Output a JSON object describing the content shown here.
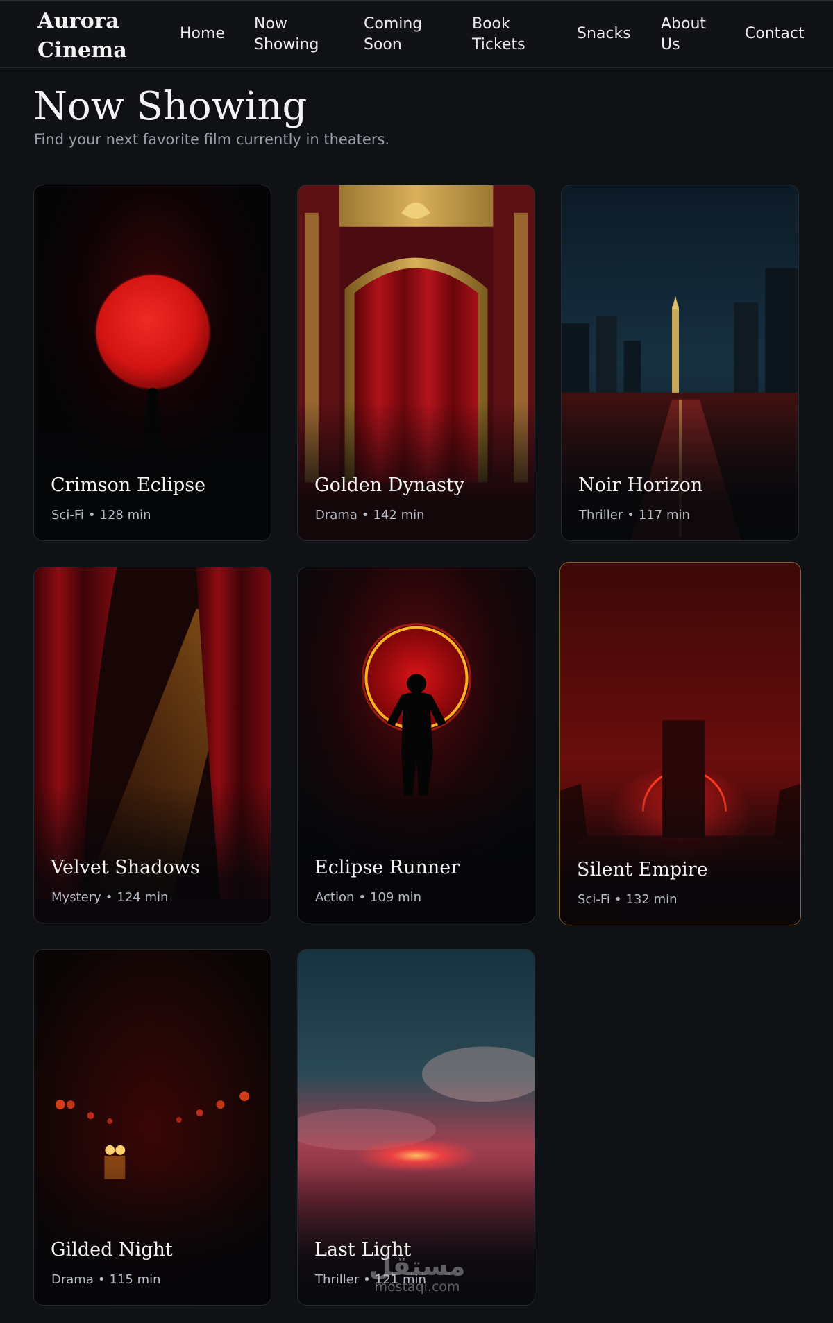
{
  "nav": {
    "brand": "Aurora Cinema",
    "links": [
      "Home",
      "Now Showing",
      "Coming Soon",
      "Book Tickets",
      "Snacks",
      "About Us",
      "Contact"
    ]
  },
  "header": {
    "title": "Now Showing",
    "subtitle": "Find your next favorite film currently in theaters."
  },
  "movies": [
    {
      "title": "Crimson Eclipse",
      "genre": "Sci-Fi",
      "duration": "128 min",
      "poster": "red-moon-silhouette"
    },
    {
      "title": "Golden Dynasty",
      "genre": "Drama",
      "duration": "142 min",
      "poster": "ornate-gold-stage-curtain"
    },
    {
      "title": "Noir Horizon",
      "genre": "Thriller",
      "duration": "117 min",
      "poster": "rainy-night-city"
    },
    {
      "title": "Velvet Shadows",
      "genre": "Mystery",
      "duration": "124 min",
      "poster": "red-curtains-spotlight"
    },
    {
      "title": "Eclipse Runner",
      "genre": "Action",
      "duration": "109 min",
      "poster": "runner-red-ring"
    },
    {
      "title": "Silent Empire",
      "genre": "Sci-Fi",
      "duration": "132 min",
      "poster": "red-monolith"
    },
    {
      "title": "Gilded Night",
      "genre": "Drama",
      "duration": "115 min",
      "poster": "blurred-red-lights"
    },
    {
      "title": "Last Light",
      "genre": "Thriller",
      "duration": "121 min",
      "poster": "red-sunset-clouds"
    }
  ],
  "meta_separator": "•",
  "watermark": {
    "logo": "مستقل",
    "domain": "mostaql.com"
  },
  "colors": {
    "background": "#0f1115",
    "nav": "#101216",
    "accent": "#d9141a",
    "highlight_border": "#8a6a2a"
  }
}
